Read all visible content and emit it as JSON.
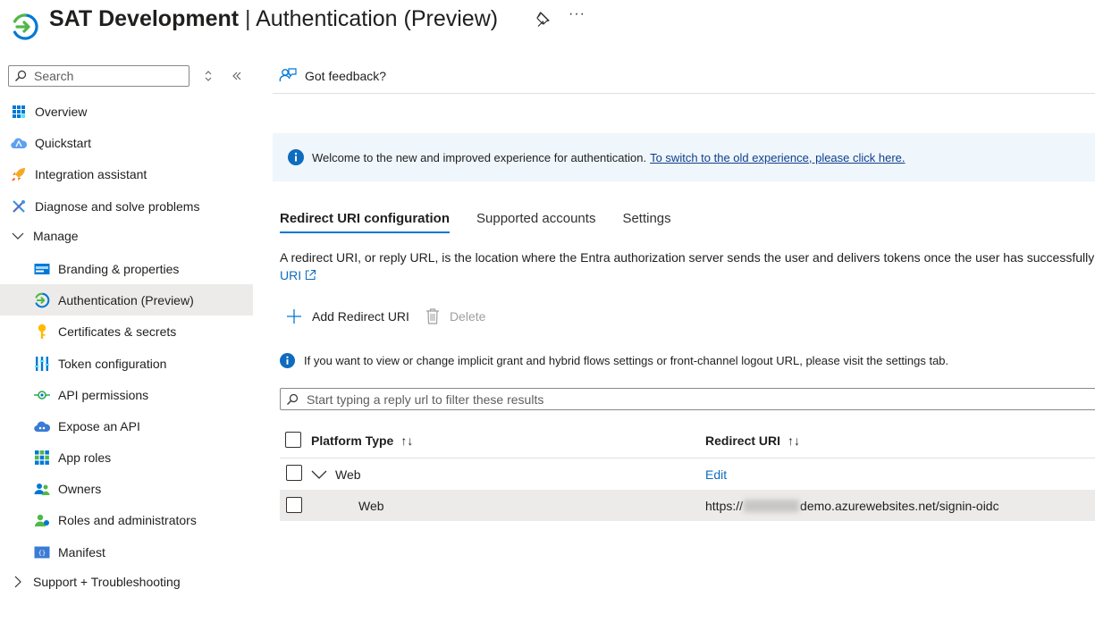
{
  "header": {
    "title_bold": "SAT Development",
    "title_separator": "|",
    "title_rest": "Authentication (Preview)",
    "pin_icon": "pin-icon",
    "more": "···"
  },
  "sidebar": {
    "search_placeholder": "Search",
    "items": [
      {
        "label": "Overview",
        "icon": "overview-grid-icon"
      },
      {
        "label": "Quickstart",
        "icon": "quickstart-cloud-icon"
      },
      {
        "label": "Integration assistant",
        "icon": "rocket-icon"
      },
      {
        "label": "Diagnose and solve problems",
        "icon": "wrench-icon"
      },
      {
        "label": "Manage",
        "icon": "chevron-down-icon"
      },
      {
        "label": "Branding & properties",
        "icon": "branding-icon"
      },
      {
        "label": "Authentication (Preview)",
        "icon": "authentication-icon"
      },
      {
        "label": "Certificates & secrets",
        "icon": "key-icon"
      },
      {
        "label": "Token configuration",
        "icon": "token-bars-icon"
      },
      {
        "label": "API permissions",
        "icon": "api-permissions-icon"
      },
      {
        "label": "Expose an API",
        "icon": "cloud-api-icon"
      },
      {
        "label": "App roles",
        "icon": "app-roles-grid-icon"
      },
      {
        "label": "Owners",
        "icon": "owners-icon"
      },
      {
        "label": "Roles and administrators",
        "icon": "roles-admin-icon"
      },
      {
        "label": "Manifest",
        "icon": "manifest-icon"
      },
      {
        "label": "Support + Troubleshooting",
        "icon": "chevron-right-icon"
      }
    ]
  },
  "main": {
    "feedback": "Got feedback?",
    "banner": {
      "text": "Welcome to the new and improved experience for authentication.",
      "link": "To switch to the old experience, please click here."
    },
    "tabs": [
      "Redirect URI configuration",
      "Supported accounts",
      "Settings"
    ],
    "description_line1": "A redirect URI, or reply URL, is the location where the Entra authorization server sends the user and delivers tokens once the user has successfully",
    "description_link": "URI",
    "toolbar": {
      "add": "Add Redirect URI",
      "delete": "Delete"
    },
    "info": "If you want to view or change implicit grant and hybrid flows settings or front-channel logout URL, please visit the settings tab.",
    "filter_placeholder": "Start typing a reply url to filter these results",
    "table": {
      "col_platform": "Platform Type",
      "col_uri": "Redirect URI",
      "sort_glyph": "↑↓",
      "group_row": {
        "platform": "Web",
        "action": "Edit"
      },
      "data_row": {
        "platform": "Web",
        "uri_prefix": "https://",
        "uri_suffix": "demo.azurewebsites.net/signin-oidc"
      }
    }
  },
  "colors": {
    "accent": "#0078d4",
    "link": "#0f6cbd",
    "banner_bg": "#eff6fc",
    "selected_bg": "#edebe9"
  }
}
